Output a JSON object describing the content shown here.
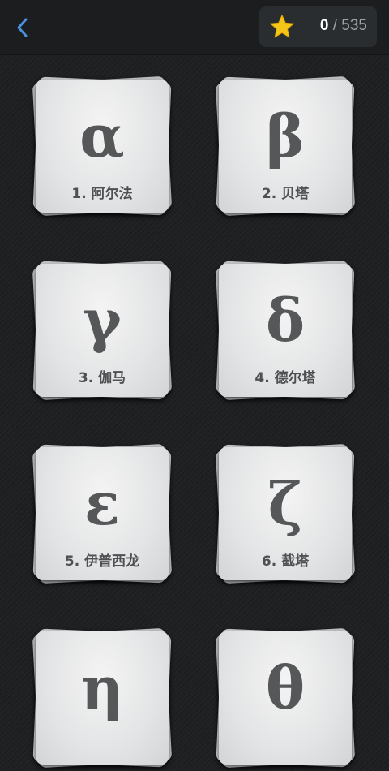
{
  "header": {
    "back_icon": "chevron-left-icon",
    "score": {
      "current": "0",
      "separator": "/",
      "total": "535"
    },
    "star_icon": "star-icon",
    "accent": "#4a8fe0",
    "star_color": "#f5c518"
  },
  "cards": [
    {
      "letter": "α",
      "label": "1. 阿尔法"
    },
    {
      "letter": "β",
      "label": "2. 贝塔"
    },
    {
      "letter": "γ",
      "label": "3. 伽马"
    },
    {
      "letter": "δ",
      "label": "4. 德尔塔"
    },
    {
      "letter": "ε",
      "label": "5. 伊普西龙"
    },
    {
      "letter": "ζ",
      "label": "6. 截塔"
    },
    {
      "letter": "η",
      "label": ""
    },
    {
      "letter": "θ",
      "label": ""
    }
  ]
}
